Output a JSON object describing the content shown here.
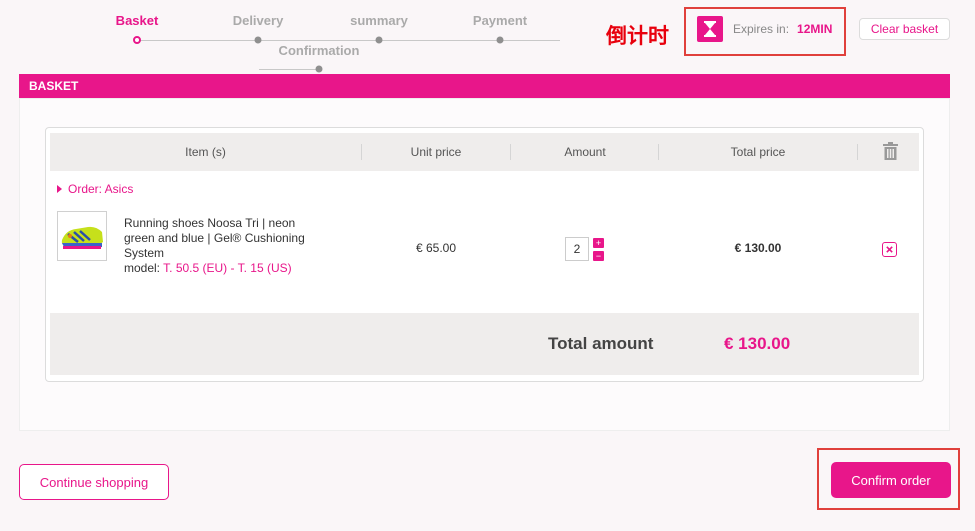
{
  "steps": [
    {
      "label": "Basket",
      "active": true
    },
    {
      "label": "Delivery"
    },
    {
      "label": "summary"
    },
    {
      "label": "Payment"
    },
    {
      "label": "Confirmation"
    }
  ],
  "annotation": "倒计时",
  "timer": {
    "label": "Expires in:",
    "value": "12MIN",
    "icon": "hourglass-icon"
  },
  "header": {
    "clear_basket": "Clear basket"
  },
  "basket": {
    "title": "BASKET",
    "columns": [
      "Item (s)",
      "Unit price",
      "Amount",
      "Total price"
    ],
    "order_label": "Order: Asics",
    "item": {
      "name": "Running shoes Noosa Tri | neon green and blue | Gel® Cushioning System",
      "model_label": "model:",
      "model_value": "T. 50.5 (EU) - T. 15 (US)",
      "unit_price": "€ 65.00",
      "quantity": "2",
      "total": "€ 130.00"
    },
    "total_label": "Total amount",
    "total_value": "€ 130.00"
  },
  "actions": {
    "continue": "Continue shopping",
    "confirm": "Confirm order"
  },
  "colors": {
    "accent": "#e8168a",
    "annotation": "#e8000d"
  }
}
